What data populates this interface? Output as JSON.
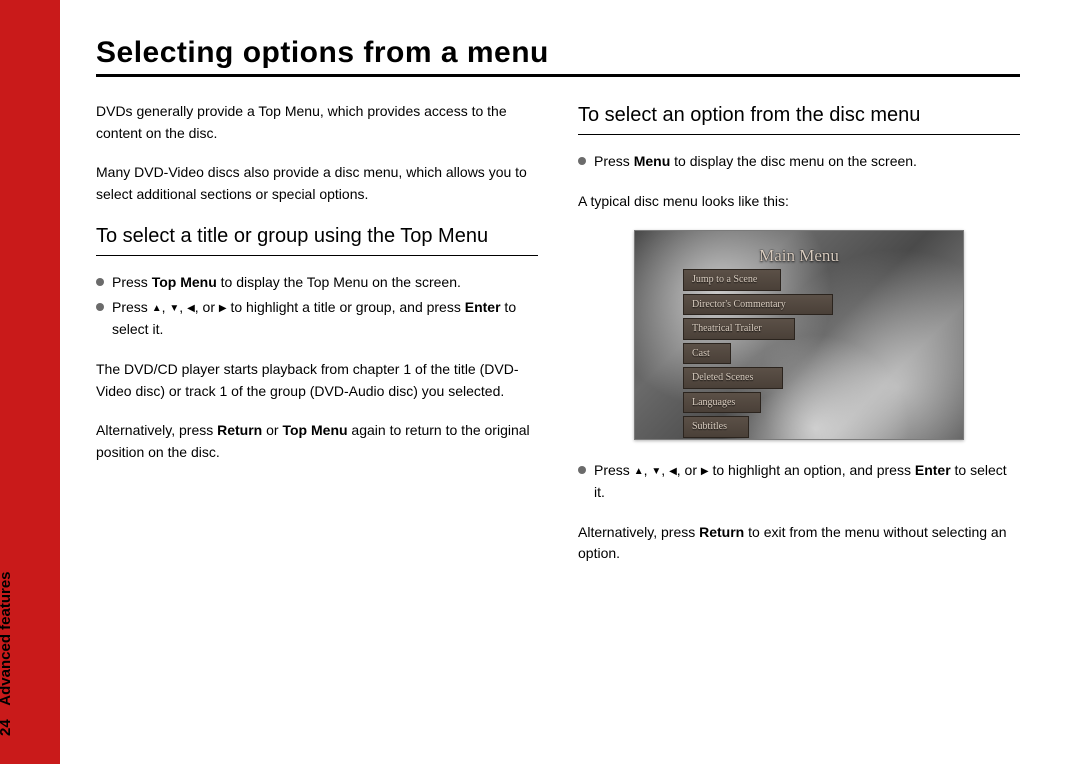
{
  "sidebar": {
    "page_number": "24",
    "section": "Advanced features"
  },
  "title": "Selecting options from a menu",
  "left": {
    "intro1": "DVDs generally provide a Top Menu, which provides access to the content on the disc.",
    "intro2": "Many DVD-Video discs also provide a disc menu, which allows you to select additional sections or special options.",
    "sub": "To select a title or group using the Top Menu",
    "b1_pre": "Press ",
    "b1_bold": "Top Menu",
    "b1_post": " to display the Top Menu on the screen.",
    "b2_pre": "Press ",
    "b2_mid": " to highlight a title or group, and press ",
    "b2_bold": "Enter",
    "b2_post": " to select it.",
    "p3": "The DVD/CD player starts playback from chapter 1 of the title (DVD-Video disc) or track 1 of the group (DVD-Audio disc) you selected.",
    "p4_pre": "Alternatively, press ",
    "p4_b1": "Return",
    "p4_mid": " or ",
    "p4_b2": "Top Menu",
    "p4_post": " again to return to the original position on the disc."
  },
  "right": {
    "sub": "To select an option from the disc menu",
    "b1_pre": "Press ",
    "b1_bold": "Menu",
    "b1_post": " to display the disc menu on the screen.",
    "p2": "A typical disc menu looks like this:",
    "disc_menu": {
      "title": "Main Menu",
      "items": [
        "Jump to a Scene",
        "Director's Commentary",
        "Theatrical Trailer",
        "Cast",
        "Deleted Scenes",
        "Languages",
        "Subtitles"
      ]
    },
    "b3_pre": "Press ",
    "b3_mid": " to highlight an option, and press ",
    "b3_bold": "Enter",
    "b3_post": " to select it.",
    "p4_pre": "Alternatively, press ",
    "p4_bold": "Return",
    "p4_post": " to exit from the menu without selecting an option."
  },
  "glyphs": {
    "up": "▲",
    "down": "▼",
    "left": "◀",
    "right": "▶",
    "comma": ", ",
    "or": ", or "
  }
}
